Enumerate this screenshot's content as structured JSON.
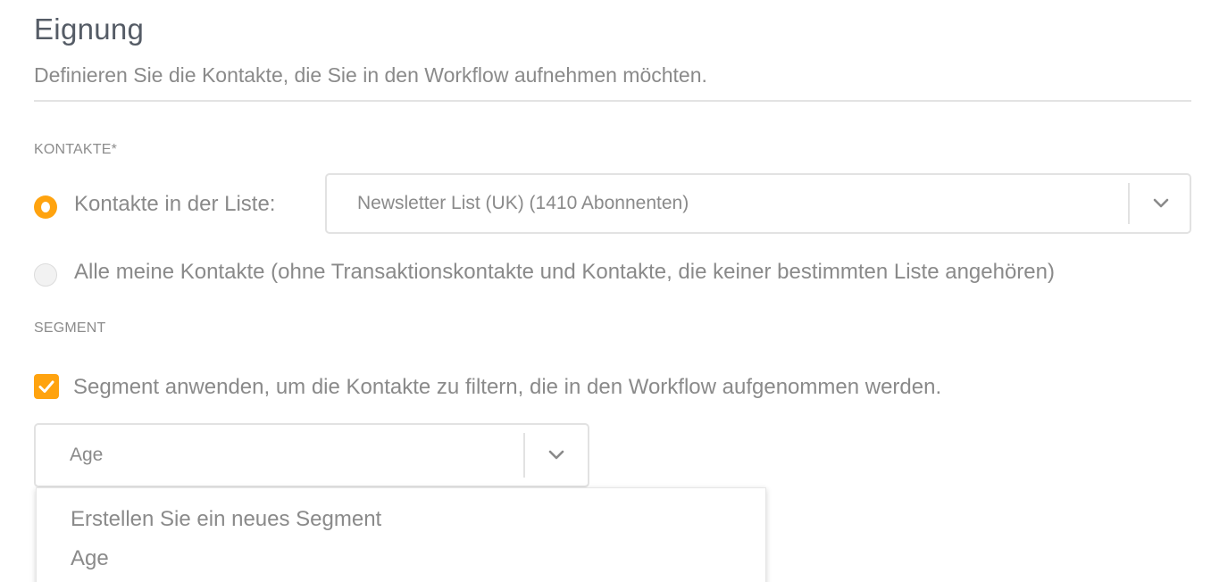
{
  "header": {
    "title": "Eignung",
    "subtitle": "Definieren Sie die Kontakte, die Sie in den Workflow aufnehmen möchten."
  },
  "contacts": {
    "section_label": "KONTAKTE*",
    "option_list_label": "Kontakte in der Liste:",
    "option_list_selected": true,
    "list_select_value": "Newsletter List (UK) (1410 Abonnenten)",
    "option_all_label": "Alle meine Kontakte (ohne Transaktionskontakte und Kontakte, die keiner bestimmten Liste angehören)",
    "option_all_selected": false
  },
  "segment": {
    "section_label": "SEGMENT",
    "apply_checkbox_label": "Segment anwenden, um die Kontakte zu filtern, die in den Workflow aufgenommen werden.",
    "apply_checked": true,
    "select_value": "Age",
    "dropdown_options": [
      "Erstellen Sie ein neues Segment",
      "Age"
    ]
  },
  "icons": {
    "chevron": "chevron-down-icon",
    "checkmark": "checkmark-icon"
  },
  "colors": {
    "accent": "#ffa30f",
    "text": "#8a8a8a",
    "title": "#555c66",
    "border": "#e2e2e2"
  }
}
